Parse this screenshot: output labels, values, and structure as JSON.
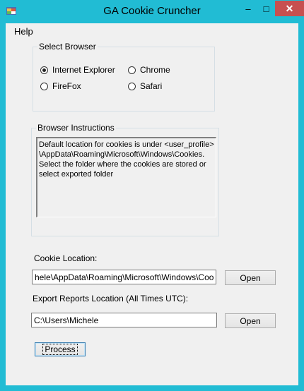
{
  "window": {
    "title": "GA Cookie Cruncher",
    "controls": {
      "minimize": "–",
      "maximize": "□",
      "close": "✕"
    },
    "accent_color": "#21bcd4",
    "close_color": "#c75050"
  },
  "menu": {
    "help": "Help"
  },
  "browser_group": {
    "legend": "Select Browser",
    "options": [
      {
        "label": "Internet Explorer",
        "checked": true
      },
      {
        "label": "Chrome",
        "checked": false
      },
      {
        "label": "FireFox",
        "checked": false
      },
      {
        "label": "Safari",
        "checked": false
      }
    ]
  },
  "instructions_group": {
    "legend": "Browser Instructions",
    "text": "Default location for cookies is under <user_profile> \\AppData\\Roaming\\Microsoft\\Windows\\Cookies. Select the folder where the cookies are stored or select exported folder"
  },
  "cookie_location": {
    "label": "Cookie Location:",
    "value": "hele\\AppData\\Roaming\\Microsoft\\Windows\\Cookies",
    "open_label": "Open"
  },
  "export_location": {
    "label": "Export Reports Location (All Times UTC):",
    "value": "C:\\Users\\Michele",
    "open_label": "Open"
  },
  "process_label": "Process"
}
